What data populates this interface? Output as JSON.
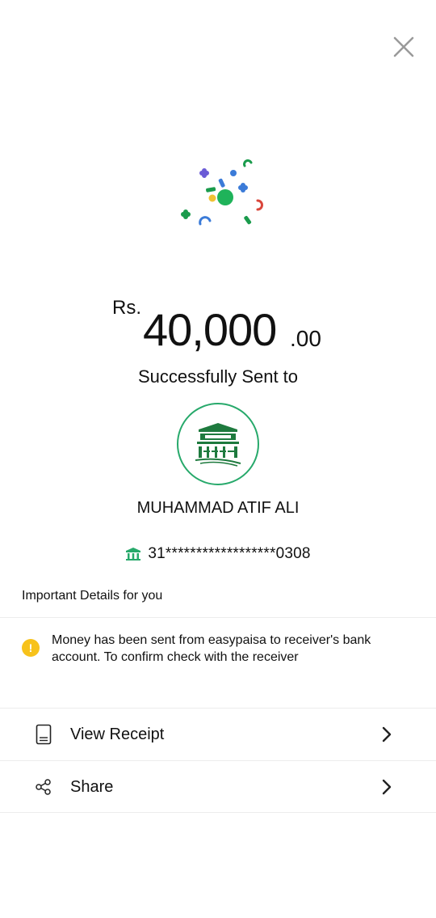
{
  "amount": {
    "currency": "Rs.",
    "main": "40,000",
    "decimal": ".00"
  },
  "status_text": "Successfully Sent to",
  "receiver": {
    "name": "MUHAMMAD ATIF ALI",
    "account_number": "31******************0308",
    "account_icon": "bank-icon",
    "logo": "bank-logo"
  },
  "details": {
    "title": "Important Details for you",
    "notice_icon": "warning-icon",
    "notice_text": "Money has been sent from easypaisa to receiver's bank account. To confirm check with the receiver"
  },
  "actions": [
    {
      "label": "View Receipt",
      "icon": "receipt-icon"
    },
    {
      "label": "Share",
      "icon": "share-icon"
    }
  ],
  "colors": {
    "accent_green": "#27a96b",
    "warning_yellow": "#f7c21b",
    "divider": "#ececec"
  }
}
